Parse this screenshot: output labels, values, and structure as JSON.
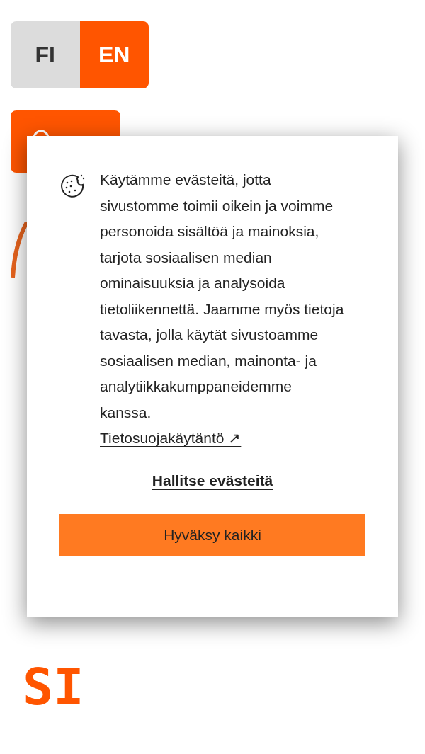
{
  "language_switch": [
    {
      "label": "FI",
      "selected": false
    },
    {
      "label": "EN",
      "selected": true
    }
  ],
  "headline_tail": "SI",
  "cookie_dialog": {
    "message": "Käytämme evästeitä, jotta sivustomme toimii oikein ja voimme personoida sisältöä ja mainoksia, tarjota sosiaalisen median ominaisuuksia ja analysoida tietoliikennettä. Jaamme myös tietoja tavasta, jolla käytät sivustoamme sosiaalisen median, mainonta- ja analytiikkakumppaneidemme kanssa.",
    "privacy_link": "Tietosuojakäytäntö ↗",
    "manage_link": "Hallitse evästeitä",
    "accept_button": "Hyväksy kaikki"
  }
}
